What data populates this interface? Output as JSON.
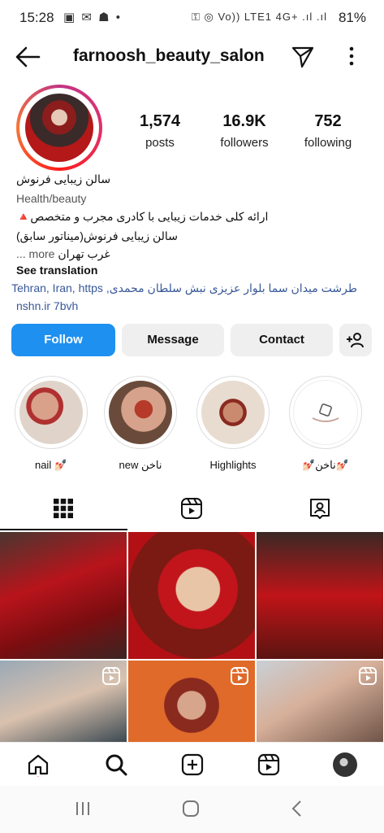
{
  "status_bar": {
    "time": "15:28",
    "left_icons": "▣ ✉ ☗ •",
    "right_icons": "⚿ ◎ Vo)) LTE1 4G+ .ıl .ıl",
    "battery": "81%"
  },
  "header": {
    "username": "farnoosh_beauty_salon",
    "back_icon": "back-arrow-icon",
    "send_icon": "paper-plane-icon",
    "more_icon": "more-vertical-icon"
  },
  "profile": {
    "stats": [
      {
        "value": "1,574",
        "label": "posts"
      },
      {
        "value": "16.9K",
        "label": "followers"
      },
      {
        "value": "752",
        "label": "following"
      }
    ],
    "name": "سالن زیبایی فرنوش",
    "category": "Health/beauty",
    "bio_line1": "ارائه کلی خدمات زیبایی با کادری مجرب و متخصص🔺",
    "bio_line2": "سالن زیبایی فرنوش(میناتور سابق)",
    "bio_line3": "غرب تهران",
    "more_label": "... more",
    "see_translation": "See translation",
    "address": "طرشت میدان سما بلوار عزیزی نبش سلطان محمدی, Tehran, Iran, https",
    "link": "nshn.ir 7bvh"
  },
  "actions": {
    "follow": "Follow",
    "message": "Message",
    "contact": "Contact",
    "add_user_icon": "add-person-icon"
  },
  "highlights": [
    {
      "label": "nail 💅🏻"
    },
    {
      "label": "new ناخن"
    },
    {
      "label": "Highlights"
    },
    {
      "label": "💅🏻ناخن💅🏻"
    }
  ],
  "tabs": [
    "grid-icon",
    "reels-icon",
    "tagged-icon"
  ],
  "bottom_nav": [
    "home-icon",
    "search-icon",
    "create-icon",
    "reels-icon",
    "profile-avatar"
  ],
  "colors": {
    "follow_blue": "#1e90f0",
    "link_blue": "#385898"
  }
}
